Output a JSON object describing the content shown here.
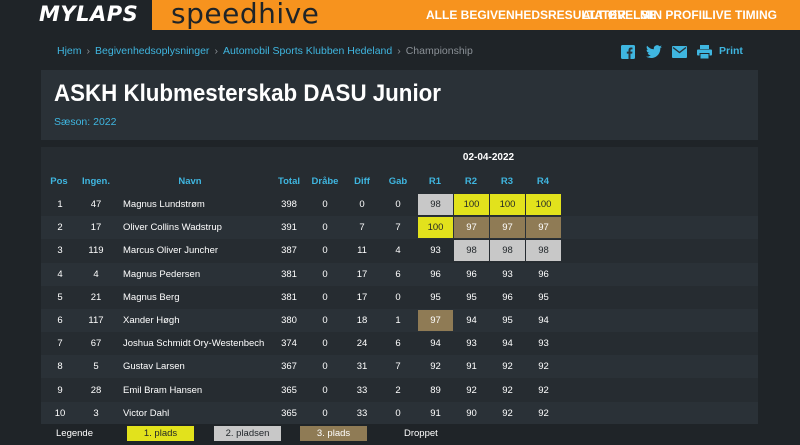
{
  "header": {
    "logo": "MYLAPS",
    "brand": "speedhive",
    "nav": [
      "ALLE BEGIVENHEDSRESULTATER",
      "ALT ØVELSE",
      "MIN PROFIL",
      "LIVE TIMING"
    ]
  },
  "breadcrumb": [
    "Hjem",
    "Begivenhedsoplysninger",
    "Automobil Sports Klubben Hedeland",
    "Championship"
  ],
  "share": {
    "print_label": "Print"
  },
  "page": {
    "title": "ASKH Klubmesterskab DASU Junior",
    "season": "Sæson: 2022"
  },
  "table": {
    "date": "02-04-2022",
    "columns": [
      "Pos",
      "Ingen.",
      "Navn",
      "Total",
      "Dråbe",
      "Diff",
      "Gab",
      "R1",
      "R2",
      "R3",
      "R4"
    ],
    "rows": [
      {
        "pos": "1",
        "no": "47",
        "name": "Magnus Lundstrøm",
        "total": "398",
        "drop": "0",
        "diff": "0",
        "gap": "0",
        "r": [
          "98",
          "100",
          "100",
          "100"
        ],
        "hl": [
          "silver",
          "gold",
          "gold",
          "gold"
        ]
      },
      {
        "pos": "2",
        "no": "17",
        "name": "Oliver Collins Wadstrup",
        "total": "391",
        "drop": "0",
        "diff": "7",
        "gap": "7",
        "r": [
          "100",
          "97",
          "97",
          "97"
        ],
        "hl": [
          "gold",
          "bronze",
          "bronze",
          "bronze"
        ]
      },
      {
        "pos": "3",
        "no": "119",
        "name": "Marcus Oliver Juncher",
        "total": "387",
        "drop": "0",
        "diff": "11",
        "gap": "4",
        "r": [
          "93",
          "98",
          "98",
          "98"
        ],
        "hl": [
          "",
          "silver",
          "silver",
          "silver"
        ]
      },
      {
        "pos": "4",
        "no": "4",
        "name": "Magnus Pedersen",
        "total": "381",
        "drop": "0",
        "diff": "17",
        "gap": "6",
        "r": [
          "96",
          "96",
          "93",
          "96"
        ],
        "hl": [
          "",
          "",
          "",
          ""
        ]
      },
      {
        "pos": "5",
        "no": "21",
        "name": "Magnus Berg",
        "total": "381",
        "drop": "0",
        "diff": "17",
        "gap": "0",
        "r": [
          "95",
          "95",
          "96",
          "95"
        ],
        "hl": [
          "",
          "",
          "",
          ""
        ]
      },
      {
        "pos": "6",
        "no": "117",
        "name": "Xander Høgh",
        "total": "380",
        "drop": "0",
        "diff": "18",
        "gap": "1",
        "r": [
          "97",
          "94",
          "95",
          "94"
        ],
        "hl": [
          "bronze",
          "",
          "",
          ""
        ]
      },
      {
        "pos": "7",
        "no": "67",
        "name": "Joshua Schmidt Ory-Westenbech",
        "total": "374",
        "drop": "0",
        "diff": "24",
        "gap": "6",
        "r": [
          "94",
          "93",
          "94",
          "93"
        ],
        "hl": [
          "",
          "",
          "",
          ""
        ]
      },
      {
        "pos": "8",
        "no": "5",
        "name": "Gustav Larsen",
        "total": "367",
        "drop": "0",
        "diff": "31",
        "gap": "7",
        "r": [
          "92",
          "91",
          "92",
          "92"
        ],
        "hl": [
          "",
          "",
          "",
          ""
        ]
      },
      {
        "pos": "9",
        "no": "28",
        "name": "Emil Bram Hansen",
        "total": "365",
        "drop": "0",
        "diff": "33",
        "gap": "2",
        "r": [
          "89",
          "92",
          "92",
          "92"
        ],
        "hl": [
          "",
          "",
          "",
          ""
        ]
      },
      {
        "pos": "10",
        "no": "3",
        "name": "Victor Dahl",
        "total": "365",
        "drop": "0",
        "diff": "33",
        "gap": "0",
        "r": [
          "91",
          "90",
          "92",
          "92"
        ],
        "hl": [
          "",
          "",
          "",
          ""
        ]
      }
    ]
  },
  "legend": {
    "label": "Legende",
    "first": "1. plads",
    "second": "2. pladsen",
    "third": "3. plads",
    "dropped": "Droppet"
  },
  "colors": {
    "accent": "#f7931e",
    "link": "#3fb6e0",
    "gold": "#e2e21c",
    "silver": "#c8c8c8",
    "bronze": "#8f7b55"
  }
}
